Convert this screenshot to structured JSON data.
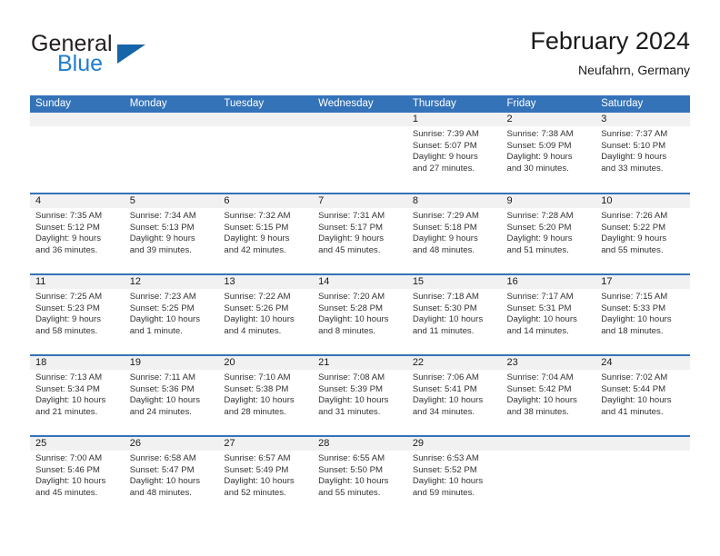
{
  "brand": {
    "name_part1": "General",
    "name_part2": "Blue",
    "logo_icon": "triangle-logo-icon"
  },
  "header": {
    "title": "February 2024",
    "location": "Neufahrn, Germany"
  },
  "colors": {
    "header_blue": "#3573b9",
    "brand_blue": "#1f7fd0",
    "daynum_band": "#f1f1f1",
    "text": "#333333"
  },
  "weekdays": [
    "Sunday",
    "Monday",
    "Tuesday",
    "Wednesday",
    "Thursday",
    "Friday",
    "Saturday"
  ],
  "weeks": [
    [
      {
        "day": "",
        "sunrise": "",
        "sunset": "",
        "daylight1": "",
        "daylight2": ""
      },
      {
        "day": "",
        "sunrise": "",
        "sunset": "",
        "daylight1": "",
        "daylight2": ""
      },
      {
        "day": "",
        "sunrise": "",
        "sunset": "",
        "daylight1": "",
        "daylight2": ""
      },
      {
        "day": "",
        "sunrise": "",
        "sunset": "",
        "daylight1": "",
        "daylight2": ""
      },
      {
        "day": "1",
        "sunrise": "Sunrise: 7:39 AM",
        "sunset": "Sunset: 5:07 PM",
        "daylight1": "Daylight: 9 hours",
        "daylight2": "and 27 minutes."
      },
      {
        "day": "2",
        "sunrise": "Sunrise: 7:38 AM",
        "sunset": "Sunset: 5:09 PM",
        "daylight1": "Daylight: 9 hours",
        "daylight2": "and 30 minutes."
      },
      {
        "day": "3",
        "sunrise": "Sunrise: 7:37 AM",
        "sunset": "Sunset: 5:10 PM",
        "daylight1": "Daylight: 9 hours",
        "daylight2": "and 33 minutes."
      }
    ],
    [
      {
        "day": "4",
        "sunrise": "Sunrise: 7:35 AM",
        "sunset": "Sunset: 5:12 PM",
        "daylight1": "Daylight: 9 hours",
        "daylight2": "and 36 minutes."
      },
      {
        "day": "5",
        "sunrise": "Sunrise: 7:34 AM",
        "sunset": "Sunset: 5:13 PM",
        "daylight1": "Daylight: 9 hours",
        "daylight2": "and 39 minutes."
      },
      {
        "day": "6",
        "sunrise": "Sunrise: 7:32 AM",
        "sunset": "Sunset: 5:15 PM",
        "daylight1": "Daylight: 9 hours",
        "daylight2": "and 42 minutes."
      },
      {
        "day": "7",
        "sunrise": "Sunrise: 7:31 AM",
        "sunset": "Sunset: 5:17 PM",
        "daylight1": "Daylight: 9 hours",
        "daylight2": "and 45 minutes."
      },
      {
        "day": "8",
        "sunrise": "Sunrise: 7:29 AM",
        "sunset": "Sunset: 5:18 PM",
        "daylight1": "Daylight: 9 hours",
        "daylight2": "and 48 minutes."
      },
      {
        "day": "9",
        "sunrise": "Sunrise: 7:28 AM",
        "sunset": "Sunset: 5:20 PM",
        "daylight1": "Daylight: 9 hours",
        "daylight2": "and 51 minutes."
      },
      {
        "day": "10",
        "sunrise": "Sunrise: 7:26 AM",
        "sunset": "Sunset: 5:22 PM",
        "daylight1": "Daylight: 9 hours",
        "daylight2": "and 55 minutes."
      }
    ],
    [
      {
        "day": "11",
        "sunrise": "Sunrise: 7:25 AM",
        "sunset": "Sunset: 5:23 PM",
        "daylight1": "Daylight: 9 hours",
        "daylight2": "and 58 minutes."
      },
      {
        "day": "12",
        "sunrise": "Sunrise: 7:23 AM",
        "sunset": "Sunset: 5:25 PM",
        "daylight1": "Daylight: 10 hours",
        "daylight2": "and 1 minute."
      },
      {
        "day": "13",
        "sunrise": "Sunrise: 7:22 AM",
        "sunset": "Sunset: 5:26 PM",
        "daylight1": "Daylight: 10 hours",
        "daylight2": "and 4 minutes."
      },
      {
        "day": "14",
        "sunrise": "Sunrise: 7:20 AM",
        "sunset": "Sunset: 5:28 PM",
        "daylight1": "Daylight: 10 hours",
        "daylight2": "and 8 minutes."
      },
      {
        "day": "15",
        "sunrise": "Sunrise: 7:18 AM",
        "sunset": "Sunset: 5:30 PM",
        "daylight1": "Daylight: 10 hours",
        "daylight2": "and 11 minutes."
      },
      {
        "day": "16",
        "sunrise": "Sunrise: 7:17 AM",
        "sunset": "Sunset: 5:31 PM",
        "daylight1": "Daylight: 10 hours",
        "daylight2": "and 14 minutes."
      },
      {
        "day": "17",
        "sunrise": "Sunrise: 7:15 AM",
        "sunset": "Sunset: 5:33 PM",
        "daylight1": "Daylight: 10 hours",
        "daylight2": "and 18 minutes."
      }
    ],
    [
      {
        "day": "18",
        "sunrise": "Sunrise: 7:13 AM",
        "sunset": "Sunset: 5:34 PM",
        "daylight1": "Daylight: 10 hours",
        "daylight2": "and 21 minutes."
      },
      {
        "day": "19",
        "sunrise": "Sunrise: 7:11 AM",
        "sunset": "Sunset: 5:36 PM",
        "daylight1": "Daylight: 10 hours",
        "daylight2": "and 24 minutes."
      },
      {
        "day": "20",
        "sunrise": "Sunrise: 7:10 AM",
        "sunset": "Sunset: 5:38 PM",
        "daylight1": "Daylight: 10 hours",
        "daylight2": "and 28 minutes."
      },
      {
        "day": "21",
        "sunrise": "Sunrise: 7:08 AM",
        "sunset": "Sunset: 5:39 PM",
        "daylight1": "Daylight: 10 hours",
        "daylight2": "and 31 minutes."
      },
      {
        "day": "22",
        "sunrise": "Sunrise: 7:06 AM",
        "sunset": "Sunset: 5:41 PM",
        "daylight1": "Daylight: 10 hours",
        "daylight2": "and 34 minutes."
      },
      {
        "day": "23",
        "sunrise": "Sunrise: 7:04 AM",
        "sunset": "Sunset: 5:42 PM",
        "daylight1": "Daylight: 10 hours",
        "daylight2": "and 38 minutes."
      },
      {
        "day": "24",
        "sunrise": "Sunrise: 7:02 AM",
        "sunset": "Sunset: 5:44 PM",
        "daylight1": "Daylight: 10 hours",
        "daylight2": "and 41 minutes."
      }
    ],
    [
      {
        "day": "25",
        "sunrise": "Sunrise: 7:00 AM",
        "sunset": "Sunset: 5:46 PM",
        "daylight1": "Daylight: 10 hours",
        "daylight2": "and 45 minutes."
      },
      {
        "day": "26",
        "sunrise": "Sunrise: 6:58 AM",
        "sunset": "Sunset: 5:47 PM",
        "daylight1": "Daylight: 10 hours",
        "daylight2": "and 48 minutes."
      },
      {
        "day": "27",
        "sunrise": "Sunrise: 6:57 AM",
        "sunset": "Sunset: 5:49 PM",
        "daylight1": "Daylight: 10 hours",
        "daylight2": "and 52 minutes."
      },
      {
        "day": "28",
        "sunrise": "Sunrise: 6:55 AM",
        "sunset": "Sunset: 5:50 PM",
        "daylight1": "Daylight: 10 hours",
        "daylight2": "and 55 minutes."
      },
      {
        "day": "29",
        "sunrise": "Sunrise: 6:53 AM",
        "sunset": "Sunset: 5:52 PM",
        "daylight1": "Daylight: 10 hours",
        "daylight2": "and 59 minutes."
      },
      {
        "day": "",
        "sunrise": "",
        "sunset": "",
        "daylight1": "",
        "daylight2": ""
      },
      {
        "day": "",
        "sunrise": "",
        "sunset": "",
        "daylight1": "",
        "daylight2": ""
      }
    ]
  ]
}
